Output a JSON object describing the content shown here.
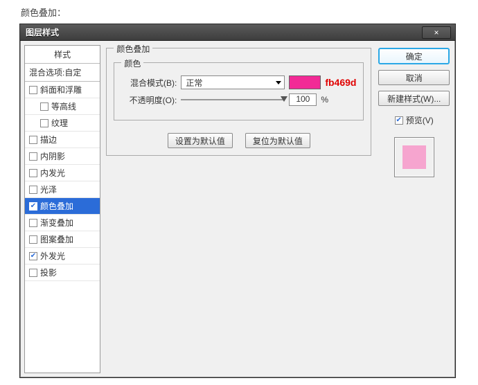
{
  "page_caption": "颜色叠加：",
  "dialog": {
    "title": "图层样式",
    "close": "×"
  },
  "styles": {
    "header": "样式",
    "blend_options": "混合选项:自定",
    "items": [
      {
        "label": "斜面和浮雕",
        "checked": false,
        "selected": false,
        "indent": false
      },
      {
        "label": "等高线",
        "checked": false,
        "selected": false,
        "indent": true
      },
      {
        "label": "纹理",
        "checked": false,
        "selected": false,
        "indent": true
      },
      {
        "label": "描边",
        "checked": false,
        "selected": false,
        "indent": false
      },
      {
        "label": "内阴影",
        "checked": false,
        "selected": false,
        "indent": false
      },
      {
        "label": "内发光",
        "checked": false,
        "selected": false,
        "indent": false
      },
      {
        "label": "光泽",
        "checked": false,
        "selected": false,
        "indent": false
      },
      {
        "label": "颜色叠加",
        "checked": true,
        "selected": true,
        "indent": false
      },
      {
        "label": "渐变叠加",
        "checked": false,
        "selected": false,
        "indent": false
      },
      {
        "label": "图案叠加",
        "checked": false,
        "selected": false,
        "indent": false
      },
      {
        "label": "外发光",
        "checked": true,
        "selected": false,
        "indent": false
      },
      {
        "label": "投影",
        "checked": false,
        "selected": false,
        "indent": false
      }
    ]
  },
  "center": {
    "group_title": "颜色叠加",
    "inner_title": "颜色",
    "blend_mode_label": "混合模式(B):",
    "blend_mode_value": "正常",
    "color_hex": "fb469d",
    "color_swatch": "#f22a96",
    "opacity_label": "不透明度(O):",
    "opacity_value": "100",
    "opacity_unit": "%",
    "set_default": "设置为默认值",
    "reset_default": "复位为默认值"
  },
  "right": {
    "ok": "确定",
    "cancel": "取消",
    "new_style": "新建样式(W)...",
    "preview_checked": true,
    "preview_label": "预览(V)",
    "preview_color": "#f6a5cf"
  }
}
